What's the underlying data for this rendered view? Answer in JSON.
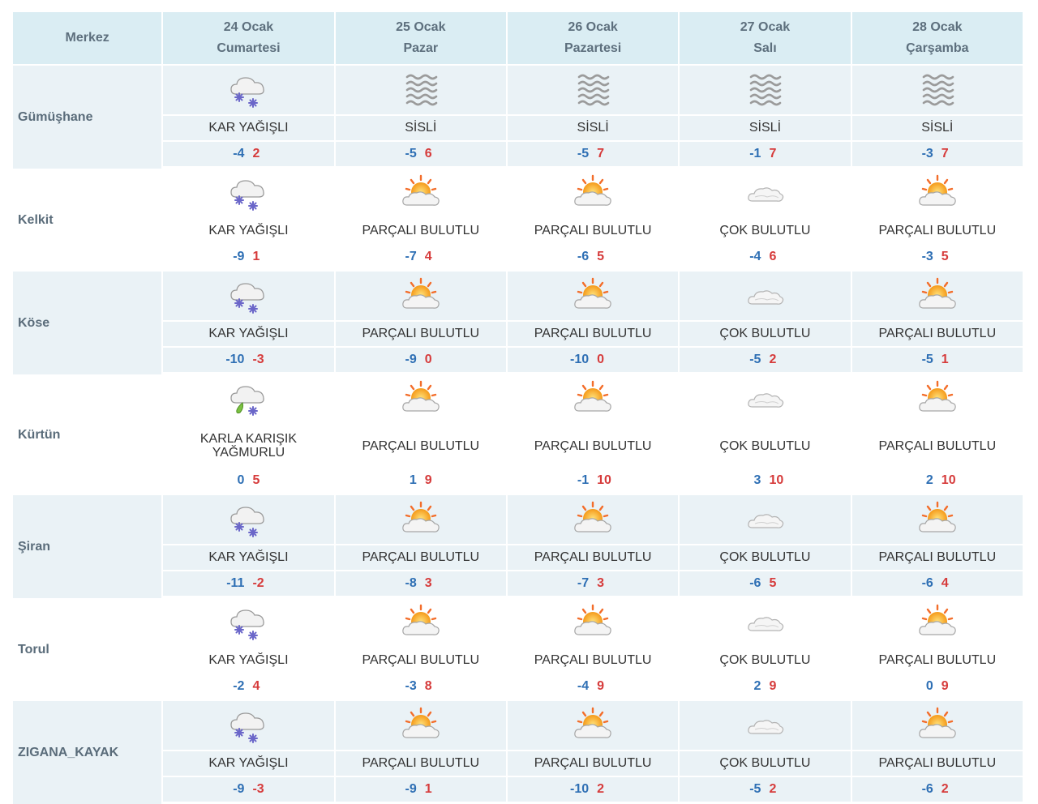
{
  "header": {
    "merkez_label": "Merkez",
    "days": [
      {
        "date": "24 Ocak",
        "weekday": "Cumartesi"
      },
      {
        "date": "25 Ocak",
        "weekday": "Pazar"
      },
      {
        "date": "26 Ocak",
        "weekday": "Pazartesi"
      },
      {
        "date": "27 Ocak",
        "weekday": "Salı"
      },
      {
        "date": "28 Ocak",
        "weekday": "Çarşamba"
      }
    ]
  },
  "colors": {
    "min_temp": "#2e6fb4",
    "max_temp": "#d63b3b",
    "header_bg": "#daedf3",
    "row_shade": "#eaf2f6"
  },
  "cities": [
    {
      "name": "Gümüşhane",
      "days": [
        {
          "icon": "snow-icon",
          "condition": "KAR YAĞIŞLI",
          "min": "-4",
          "max": "2"
        },
        {
          "icon": "fog-icon",
          "condition": "SİSLİ",
          "min": "-5",
          "max": "6"
        },
        {
          "icon": "fog-icon",
          "condition": "SİSLİ",
          "min": "-5",
          "max": "7"
        },
        {
          "icon": "fog-icon",
          "condition": "SİSLİ",
          "min": "-1",
          "max": "7"
        },
        {
          "icon": "fog-icon",
          "condition": "SİSLİ",
          "min": "-3",
          "max": "7"
        }
      ]
    },
    {
      "name": "Kelkit",
      "days": [
        {
          "icon": "snow-icon",
          "condition": "KAR YAĞIŞLI",
          "min": "-9",
          "max": "1"
        },
        {
          "icon": "partly-cloudy-icon",
          "condition": "PARÇALI BULUTLU",
          "min": "-7",
          "max": "4"
        },
        {
          "icon": "partly-cloudy-icon",
          "condition": "PARÇALI BULUTLU",
          "min": "-6",
          "max": "5"
        },
        {
          "icon": "cloudy-icon",
          "condition": "ÇOK BULUTLU",
          "min": "-4",
          "max": "6"
        },
        {
          "icon": "partly-cloudy-icon",
          "condition": "PARÇALI BULUTLU",
          "min": "-3",
          "max": "5"
        }
      ]
    },
    {
      "name": "Köse",
      "days": [
        {
          "icon": "snow-icon",
          "condition": "KAR YAĞIŞLI",
          "min": "-10",
          "max": "-3"
        },
        {
          "icon": "partly-cloudy-icon",
          "condition": "PARÇALI BULUTLU",
          "min": "-9",
          "max": "0"
        },
        {
          "icon": "partly-cloudy-icon",
          "condition": "PARÇALI BULUTLU",
          "min": "-10",
          "max": "0"
        },
        {
          "icon": "cloudy-icon",
          "condition": "ÇOK BULUTLU",
          "min": "-5",
          "max": "2"
        },
        {
          "icon": "partly-cloudy-icon",
          "condition": "PARÇALI BULUTLU",
          "min": "-5",
          "max": "1"
        }
      ]
    },
    {
      "name": "Kürtün",
      "days": [
        {
          "icon": "sleet-icon",
          "condition": "KARLA KARIŞIK YAĞMURLU",
          "min": "0",
          "max": "5"
        },
        {
          "icon": "partly-cloudy-icon",
          "condition": "PARÇALI BULUTLU",
          "min": "1",
          "max": "9"
        },
        {
          "icon": "partly-cloudy-icon",
          "condition": "PARÇALI BULUTLU",
          "min": "-1",
          "max": "10"
        },
        {
          "icon": "cloudy-icon",
          "condition": "ÇOK BULUTLU",
          "min": "3",
          "max": "10"
        },
        {
          "icon": "partly-cloudy-icon",
          "condition": "PARÇALI BULUTLU",
          "min": "2",
          "max": "10"
        }
      ]
    },
    {
      "name": "Şiran",
      "days": [
        {
          "icon": "snow-icon",
          "condition": "KAR YAĞIŞLI",
          "min": "-11",
          "max": "-2"
        },
        {
          "icon": "partly-cloudy-icon",
          "condition": "PARÇALI BULUTLU",
          "min": "-8",
          "max": "3"
        },
        {
          "icon": "partly-cloudy-icon",
          "condition": "PARÇALI BULUTLU",
          "min": "-7",
          "max": "3"
        },
        {
          "icon": "cloudy-icon",
          "condition": "ÇOK BULUTLU",
          "min": "-6",
          "max": "5"
        },
        {
          "icon": "partly-cloudy-icon",
          "condition": "PARÇALI BULUTLU",
          "min": "-6",
          "max": "4"
        }
      ]
    },
    {
      "name": "Torul",
      "days": [
        {
          "icon": "snow-icon",
          "condition": "KAR YAĞIŞLI",
          "min": "-2",
          "max": "4"
        },
        {
          "icon": "partly-cloudy-icon",
          "condition": "PARÇALI BULUTLU",
          "min": "-3",
          "max": "8"
        },
        {
          "icon": "partly-cloudy-icon",
          "condition": "PARÇALI BULUTLU",
          "min": "-4",
          "max": "9"
        },
        {
          "icon": "cloudy-icon",
          "condition": "ÇOK BULUTLU",
          "min": "2",
          "max": "9"
        },
        {
          "icon": "partly-cloudy-icon",
          "condition": "PARÇALI BULUTLU",
          "min": "0",
          "max": "9"
        }
      ]
    },
    {
      "name": "ZIGANA_KAYAK",
      "days": [
        {
          "icon": "snow-icon",
          "condition": "KAR YAĞIŞLI",
          "min": "-9",
          "max": "-3"
        },
        {
          "icon": "partly-cloudy-icon",
          "condition": "PARÇALI BULUTLU",
          "min": "-9",
          "max": "1"
        },
        {
          "icon": "partly-cloudy-icon",
          "condition": "PARÇALI BULUTLU",
          "min": "-10",
          "max": "2"
        },
        {
          "icon": "cloudy-icon",
          "condition": "ÇOK BULUTLU",
          "min": "-5",
          "max": "2"
        },
        {
          "icon": "partly-cloudy-icon",
          "condition": "PARÇALI BULUTLU",
          "min": "-6",
          "max": "2"
        }
      ]
    }
  ]
}
